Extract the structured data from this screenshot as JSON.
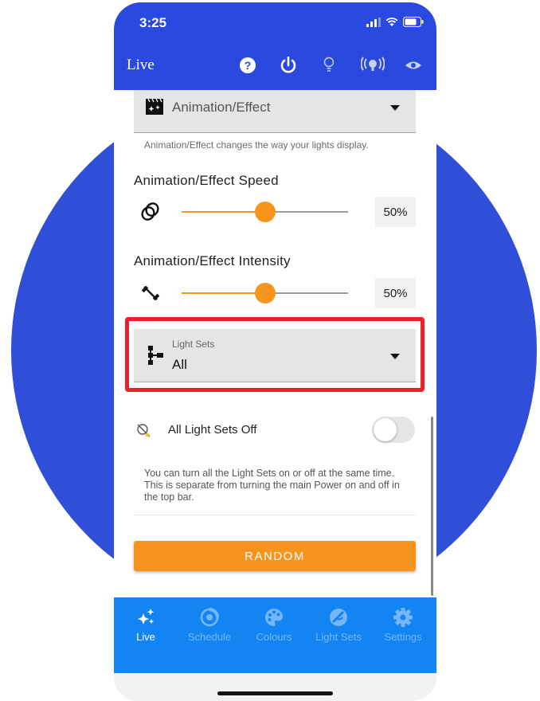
{
  "status_bar": {
    "time": "3:25"
  },
  "header": {
    "title": "Live",
    "icons": [
      "help-icon",
      "power-icon",
      "bulb-icon",
      "broadcast-icon",
      "eye-icon"
    ]
  },
  "animation_dropdown": {
    "label": "Animation/Effect",
    "helper": "Animation/Effect changes the way your lights display."
  },
  "speed": {
    "title": "Animation/Effect Speed",
    "value_label": "50%",
    "value": 0.5
  },
  "intensity": {
    "title": "Animation/Effect Intensity",
    "value_label": "50%",
    "value": 0.5
  },
  "light_sets": {
    "label": "Light Sets",
    "value": "All"
  },
  "all_off": {
    "label": "All Light Sets Off",
    "enabled": false,
    "note": "You can turn all the Light Sets on or off at the same time. This is separate from turning the main Power on and off in the top bar."
  },
  "random_button": {
    "label": "RANDOM"
  },
  "tabs": [
    {
      "label": "Live",
      "icon": "sparkles-icon",
      "active": true
    },
    {
      "label": "Schedule",
      "icon": "schedule-icon",
      "active": false
    },
    {
      "label": "Colours",
      "icon": "palette-icon",
      "active": false
    },
    {
      "label": "Light Sets",
      "icon": "light-sets-icon",
      "active": false
    },
    {
      "label": "Settings",
      "icon": "gear-icon",
      "active": false
    }
  ],
  "colors": {
    "header_blue": "#2a49df",
    "tabbar_blue": "#1385f2",
    "accent_orange": "#f7941d",
    "highlight_red": "#ef1f2a",
    "background_circle": "#2f4fd9"
  }
}
